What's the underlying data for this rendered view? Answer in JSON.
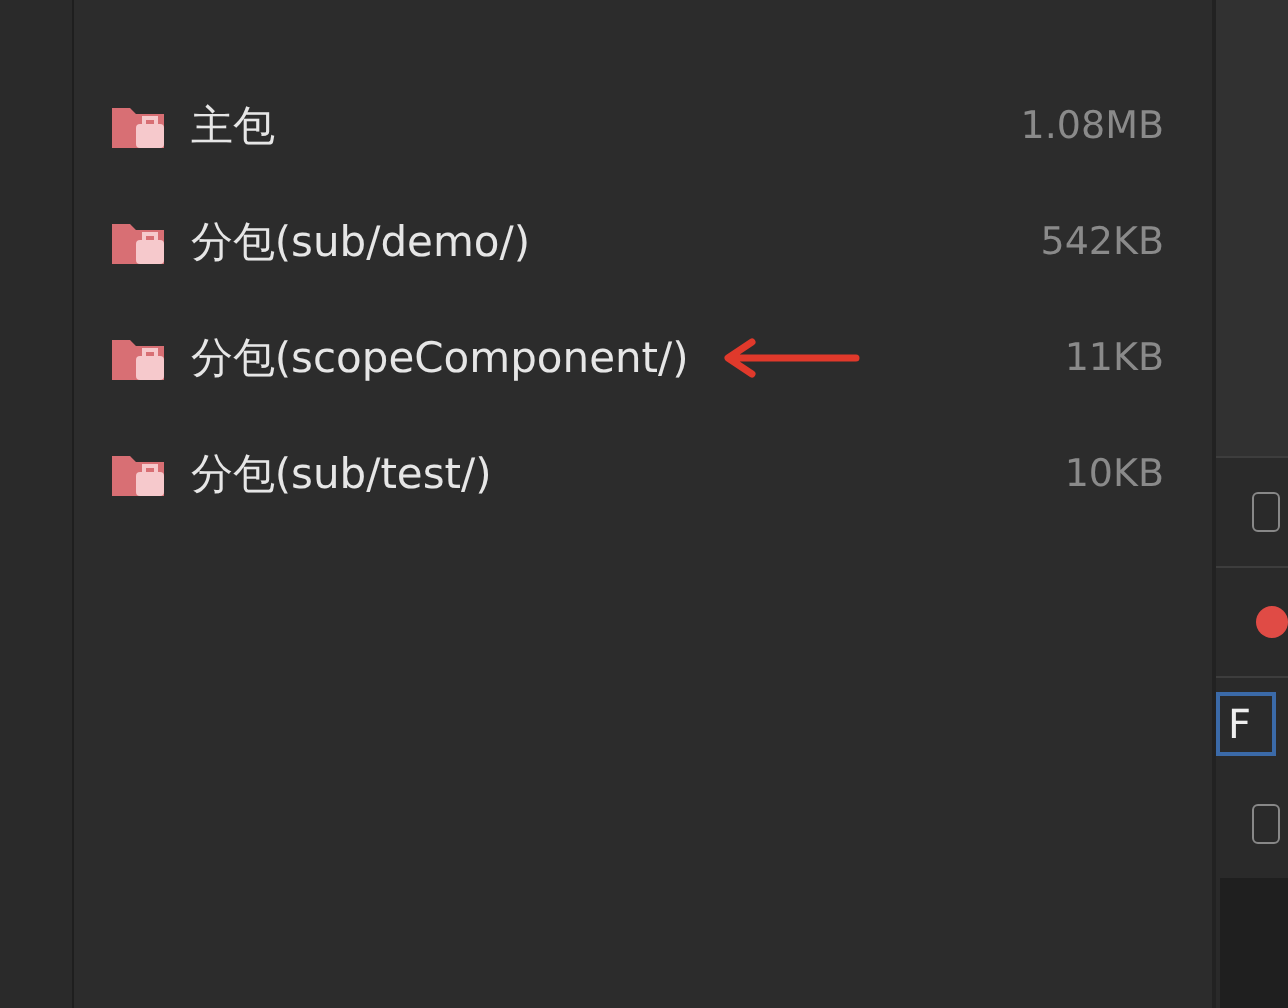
{
  "packages": [
    {
      "name": "主包",
      "size": "1.08MB",
      "highlighted": false
    },
    {
      "name": "分包(sub/demo/)",
      "size": "542KB",
      "highlighted": false
    },
    {
      "name": "分包(scopeComponent/)",
      "size": "11KB",
      "highlighted": true
    },
    {
      "name": "分包(sub/test/)",
      "size": "10KB",
      "highlighted": false
    }
  ],
  "side_panel": {
    "checkbox_1": {
      "checked": false
    },
    "field": {
      "value": "F"
    },
    "checkbox_2": {
      "checked": false
    }
  }
}
